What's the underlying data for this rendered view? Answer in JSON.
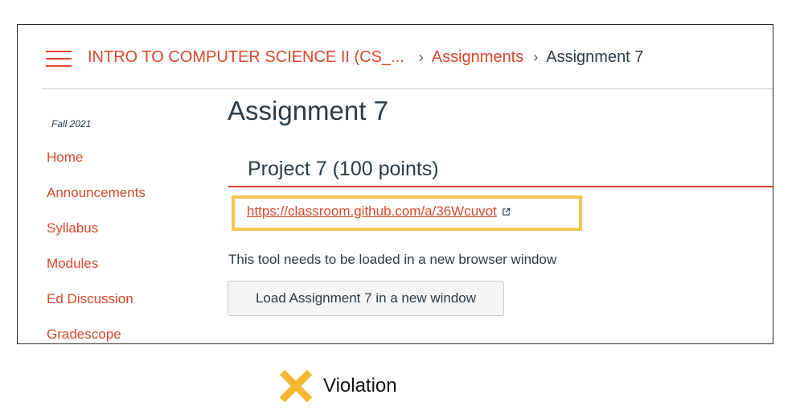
{
  "header": {
    "menu_icon": "hamburger-menu-icon",
    "breadcrumb": {
      "course": "INTRO TO COMPUTER SCIENCE II (CS_...",
      "section": "Assignments",
      "current": "Assignment 7"
    }
  },
  "sidebar": {
    "term": "Fall 2021",
    "items": [
      {
        "label": "Home"
      },
      {
        "label": "Announcements"
      },
      {
        "label": "Syllabus"
      },
      {
        "label": "Modules"
      },
      {
        "label": "Ed Discussion"
      },
      {
        "label": "Gradescope"
      }
    ]
  },
  "main": {
    "title": "Assignment 7",
    "section_heading": "Project 7 (100 points)",
    "link": {
      "text": "https://classroom.github.com/a/36Wcuvot",
      "icon": "external-link-icon"
    },
    "tool_note": "This tool needs to be loaded in a new browser window",
    "load_button": "Load Assignment 7 in a new window"
  },
  "annotation": {
    "label": "Violation",
    "icon": "x-mark-icon"
  },
  "colors": {
    "accent": "#d9472b",
    "text": "#2d3b45",
    "highlight": "#f5c451",
    "violation": "#f5b731"
  }
}
